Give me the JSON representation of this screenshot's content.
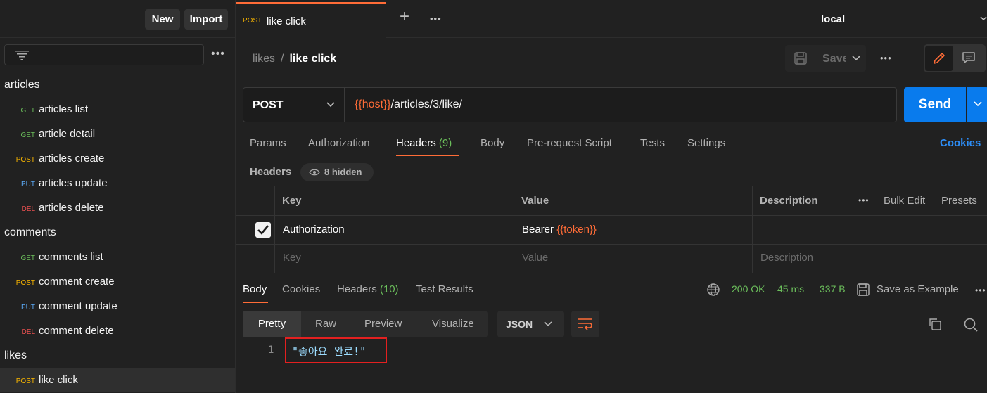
{
  "sidebar": {
    "new_label": "New",
    "import_label": "Import",
    "items": [
      {
        "type": "folder",
        "label": "articles"
      },
      {
        "type": "request",
        "method": "GET",
        "label": "articles list"
      },
      {
        "type": "request",
        "method": "GET",
        "label": "article detail"
      },
      {
        "type": "request",
        "method": "POST",
        "label": "articles create"
      },
      {
        "type": "request",
        "method": "PUT",
        "label": "articles update"
      },
      {
        "type": "request",
        "method": "DEL",
        "label": "articles delete"
      },
      {
        "type": "folder",
        "label": "comments"
      },
      {
        "type": "request",
        "method": "GET",
        "label": "comments list"
      },
      {
        "type": "request",
        "method": "POST",
        "label": "comment create"
      },
      {
        "type": "request",
        "method": "PUT",
        "label": "comment update"
      },
      {
        "type": "request",
        "method": "DEL",
        "label": "comment delete"
      },
      {
        "type": "folder",
        "label": "likes"
      },
      {
        "type": "request",
        "method": "POST",
        "label": "like click",
        "active": true
      }
    ]
  },
  "tabs": {
    "active": {
      "method": "POST",
      "label": "like click"
    },
    "environment": "local"
  },
  "breadcrumb": {
    "parent": "likes",
    "separator": "/",
    "current": "like click"
  },
  "toolbar": {
    "save_label": "Save"
  },
  "request": {
    "method": "POST",
    "url_var": "{{host}}",
    "url_rest": "/articles/3/like/",
    "send_label": "Send"
  },
  "request_tabs": {
    "params": "Params",
    "authorization": "Authorization",
    "headers": "Headers",
    "headers_count": "(9)",
    "body": "Body",
    "prerequest": "Pre-request Script",
    "tests": "Tests",
    "settings": "Settings",
    "cookies": "Cookies"
  },
  "headers_section": {
    "label": "Headers",
    "hidden": "8 hidden",
    "columns": {
      "key": "Key",
      "value": "Value",
      "description": "Description"
    },
    "bulk_edit": "Bulk Edit",
    "presets": "Presets",
    "rows": [
      {
        "checked": true,
        "key": "Authorization",
        "value_prefix": "Bearer ",
        "value_var": "{{token}}",
        "description": ""
      }
    ],
    "placeholders": {
      "key": "Key",
      "value": "Value",
      "description": "Description"
    }
  },
  "response": {
    "tabs": {
      "body": "Body",
      "cookies": "Cookies",
      "headers": "Headers",
      "headers_count": "(10)",
      "test_results": "Test Results"
    },
    "status": "200 OK",
    "time": "45 ms",
    "size": "337 B",
    "save_example": "Save as Example",
    "views": {
      "pretty": "Pretty",
      "raw": "Raw",
      "preview": "Preview",
      "visualize": "Visualize"
    },
    "format": "JSON",
    "lines": [
      {
        "no": "1",
        "text": "\"좋아요 완료!\""
      }
    ]
  },
  "colors": {
    "accent": "#ff6c37",
    "send": "#097bed",
    "get": "#6bbd5b",
    "post": "#f6b400",
    "put": "#5aa7f2",
    "del": "#e85050",
    "status_ok": "#6bbd5b",
    "highlight": "#e32020"
  }
}
